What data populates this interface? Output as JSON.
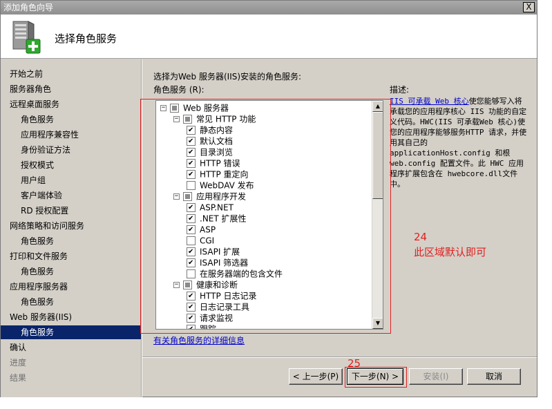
{
  "window": {
    "title": "添加角色向导",
    "close_label": "X"
  },
  "header": {
    "icon": "server-add-icon",
    "title": "选择角色服务"
  },
  "sidebar": {
    "items": [
      {
        "label": "开始之前",
        "level": 1,
        "state": "normal"
      },
      {
        "label": "服务器角色",
        "level": 1,
        "state": "normal"
      },
      {
        "label": "远程桌面服务",
        "level": 1,
        "state": "normal"
      },
      {
        "label": "角色服务",
        "level": 2,
        "state": "normal"
      },
      {
        "label": "应用程序兼容性",
        "level": 2,
        "state": "normal"
      },
      {
        "label": "身份验证方法",
        "level": 2,
        "state": "normal"
      },
      {
        "label": "授权模式",
        "level": 2,
        "state": "normal"
      },
      {
        "label": "用户组",
        "level": 2,
        "state": "normal"
      },
      {
        "label": "客户端体验",
        "level": 2,
        "state": "normal"
      },
      {
        "label": "RD 授权配置",
        "level": 2,
        "state": "normal"
      },
      {
        "label": "网络策略和访问服务",
        "level": 1,
        "state": "normal"
      },
      {
        "label": "角色服务",
        "level": 2,
        "state": "normal"
      },
      {
        "label": "打印和文件服务",
        "level": 1,
        "state": "normal"
      },
      {
        "label": "角色服务",
        "level": 2,
        "state": "normal"
      },
      {
        "label": "应用程序服务器",
        "level": 1,
        "state": "normal"
      },
      {
        "label": "角色服务",
        "level": 2,
        "state": "normal"
      },
      {
        "label": "Web 服务器(IIS)",
        "level": 1,
        "state": "normal"
      },
      {
        "label": "角色服务",
        "level": 2,
        "state": "selected"
      },
      {
        "label": "确认",
        "level": 1,
        "state": "normal"
      },
      {
        "label": "进度",
        "level": 1,
        "state": "disabled"
      },
      {
        "label": "结果",
        "level": 1,
        "state": "disabled"
      }
    ]
  },
  "main": {
    "prompt": "选择为Web 服务器(IIS)安装的角色服务:",
    "list_label": "角色服务 (R):",
    "description_label": "描述:",
    "description_link": "IIS 可承载 Web 核心",
    "description_text": "使您能够写入将承载您的应用程序核心 IIS 功能的自定义代码。HWC(IIS 可承载Web 核心)使您的应用程序能够服务HTTP 请求，并使用其自己的applicationHost.config 和根web.config 配置文件。此 HWC 应用程序扩展包含在 hwebcore.dll文件中。",
    "more_link": "有关角色服务的详细信息",
    "tree": [
      {
        "label": "Web 服务器",
        "depth": 0,
        "expander": "⊟",
        "check": "partial"
      },
      {
        "label": "常见 HTTP 功能",
        "depth": 1,
        "expander": "⊟",
        "check": "partial"
      },
      {
        "label": "静态内容",
        "depth": 2,
        "expander": "",
        "check": "checked"
      },
      {
        "label": "默认文档",
        "depth": 2,
        "expander": "",
        "check": "checked"
      },
      {
        "label": "目录浏览",
        "depth": 2,
        "expander": "",
        "check": "checked"
      },
      {
        "label": "HTTP 错误",
        "depth": 2,
        "expander": "",
        "check": "checked"
      },
      {
        "label": "HTTP 重定向",
        "depth": 2,
        "expander": "",
        "check": "checked"
      },
      {
        "label": "WebDAV 发布",
        "depth": 2,
        "expander": "",
        "check": "unchecked"
      },
      {
        "label": "应用程序开发",
        "depth": 1,
        "expander": "⊟",
        "check": "partial"
      },
      {
        "label": "ASP.NET",
        "depth": 2,
        "expander": "",
        "check": "checked"
      },
      {
        "label": ".NET 扩展性",
        "depth": 2,
        "expander": "",
        "check": "checked"
      },
      {
        "label": "ASP",
        "depth": 2,
        "expander": "",
        "check": "checked"
      },
      {
        "label": "CGI",
        "depth": 2,
        "expander": "",
        "check": "unchecked"
      },
      {
        "label": "ISAPI 扩展",
        "depth": 2,
        "expander": "",
        "check": "checked"
      },
      {
        "label": "ISAPI 筛选器",
        "depth": 2,
        "expander": "",
        "check": "checked"
      },
      {
        "label": "在服务器端的包含文件",
        "depth": 2,
        "expander": "",
        "check": "unchecked"
      },
      {
        "label": "健康和诊断",
        "depth": 1,
        "expander": "⊟",
        "check": "partial"
      },
      {
        "label": "HTTP 日志记录",
        "depth": 2,
        "expander": "",
        "check": "checked"
      },
      {
        "label": "日志记录工具",
        "depth": 2,
        "expander": "",
        "check": "checked"
      },
      {
        "label": "请求监视",
        "depth": 2,
        "expander": "",
        "check": "checked"
      },
      {
        "label": "跟踪",
        "depth": 2,
        "expander": "",
        "check": "checked"
      }
    ]
  },
  "annotations": {
    "note_24_num": "24",
    "note_24_text": "此区域默认即可",
    "note_25_num": "25"
  },
  "buttons": {
    "back": "< 上一步(P)",
    "next": "下一步(N) >",
    "install": "安装(I)",
    "cancel": "取消"
  },
  "colors": {
    "annotation_red": "#e02020",
    "selection_blue": "#0a246a",
    "dialog_gray": "#d4d0c8"
  }
}
